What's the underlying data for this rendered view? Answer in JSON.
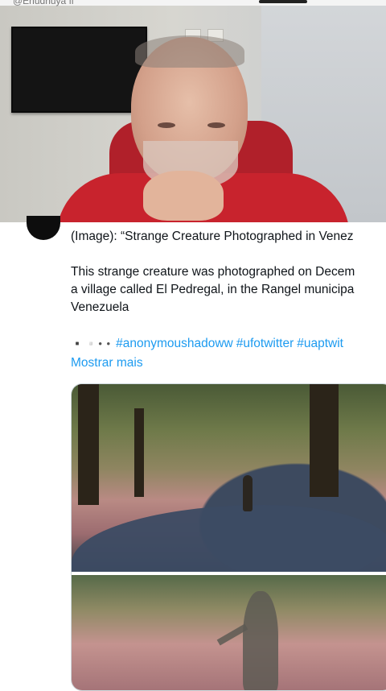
{
  "overlay": {
    "handle_fragment": "@Ehudhuya fi",
    "description": "webcam overlay"
  },
  "tweet": {
    "image_title_line": "(Image): “Strange Creature Photographed in Venez",
    "body_lines": [
      "This strange creature was photographed on Decem",
      "a village called El Pedregal, in the Rangel municipa",
      "Venezuela"
    ],
    "emoji_text": "▪️▫️• •",
    "hashtags": [
      "#anonymoushadoww",
      "#ufotwitter",
      "#uaptwit"
    ],
    "show_more": "Mostrar mais"
  },
  "colors": {
    "link": "#1d9bf0",
    "text": "#0f1419",
    "shirt": "#c8232d"
  }
}
